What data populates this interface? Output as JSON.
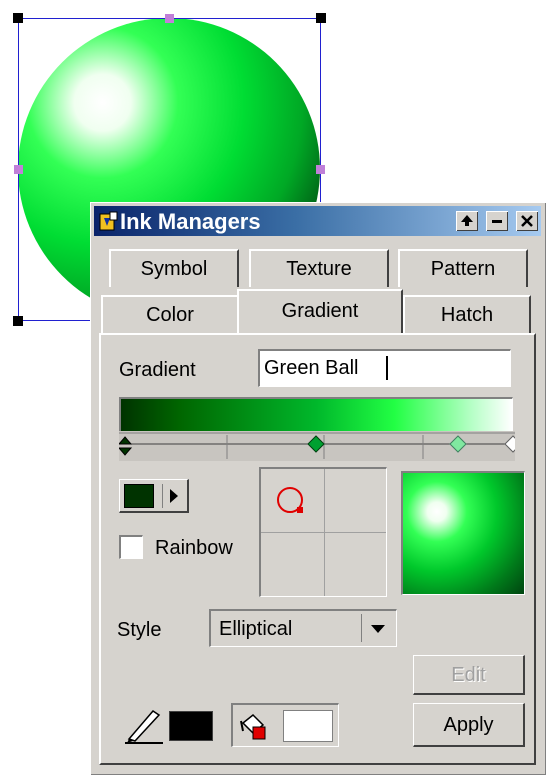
{
  "canvas": {
    "shape": "sphere",
    "fill_color": "#00cc33"
  },
  "panel": {
    "title": "Ink Managers",
    "tabs_back": [
      "Symbol",
      "Texture",
      "Pattern"
    ],
    "tabs_front": [
      "Color",
      "Gradient",
      "Hatch"
    ],
    "active_tab": "Gradient",
    "gradient_label": "Gradient",
    "gradient_name": "Green Ball",
    "gradient_colors": [
      "#003300",
      "#00dd33",
      "#ffffff"
    ],
    "rainbow_label": "Rainbow",
    "rainbow_checked": false,
    "style_label": "Style",
    "style_value": "Elliptical",
    "edit_label": "Edit",
    "apply_label": "Apply",
    "stop_color": "#003300",
    "line_color": "#000000"
  }
}
